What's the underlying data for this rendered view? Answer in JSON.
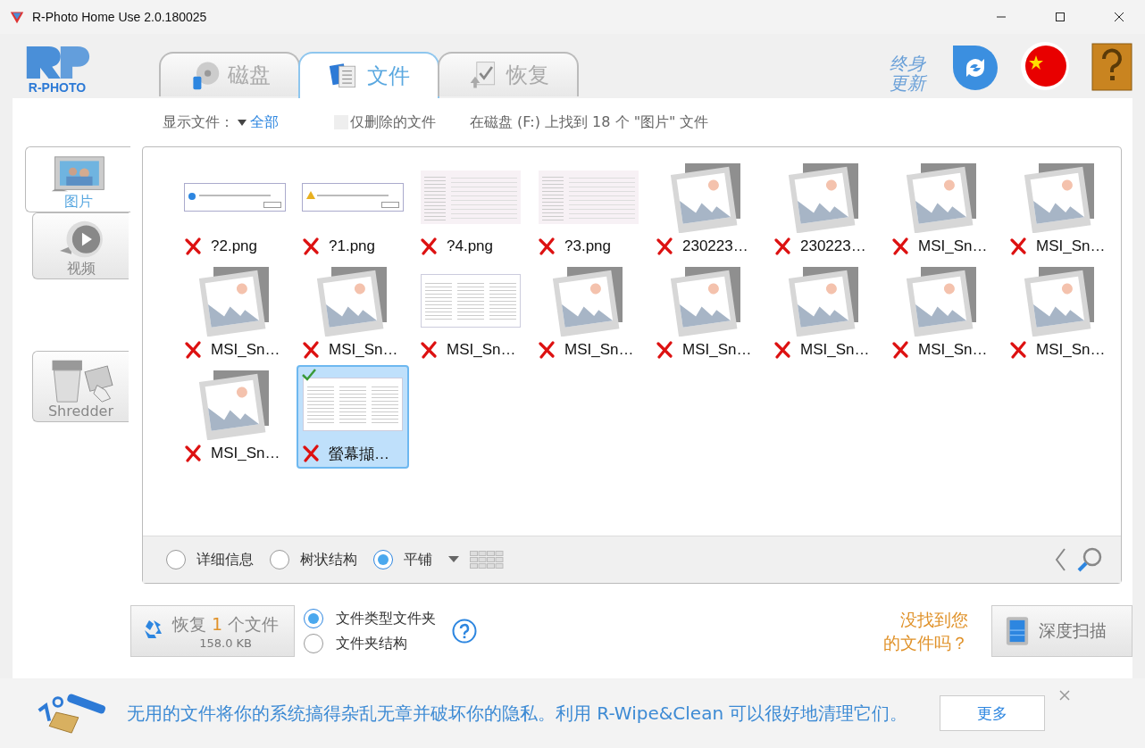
{
  "window": {
    "title": "R-Photo Home Use 2.0.180025"
  },
  "logo": {
    "text": "R-PHOTO"
  },
  "tabs": [
    {
      "label": "磁盘",
      "selected": false,
      "kind": "disk"
    },
    {
      "label": "文件",
      "selected": true,
      "kind": "files"
    },
    {
      "label": "恢复",
      "selected": false,
      "kind": "recover"
    }
  ],
  "update": {
    "lines": [
      "终身",
      "更新"
    ]
  },
  "filter": {
    "label": "显示文件：",
    "value": "全部",
    "deleted_only": {
      "label": "仅删除的文件",
      "checked": false
    },
    "summary": "在磁盘 (F:) 上找到 18 个 \"图片\" 文件"
  },
  "categories": [
    {
      "label": "图片",
      "selected": true,
      "kind": "photo"
    },
    {
      "label": "视频",
      "selected": false,
      "kind": "video"
    },
    {
      "label": "Shredder",
      "selected": false,
      "kind": "shredder"
    }
  ],
  "files": [
    {
      "name": "?2.png",
      "kind": "dialog",
      "selected": false,
      "checked": false
    },
    {
      "name": "?1.png",
      "kind": "warning",
      "selected": false,
      "checked": false
    },
    {
      "name": "?4.png",
      "kind": "page",
      "selected": false,
      "checked": false
    },
    {
      "name": "?3.png",
      "kind": "page",
      "selected": false,
      "checked": false
    },
    {
      "name": "230223…",
      "kind": "placeholder",
      "selected": false,
      "checked": false
    },
    {
      "name": "230223…",
      "kind": "placeholder",
      "selected": false,
      "checked": false
    },
    {
      "name": "MSI_Sn…",
      "kind": "placeholder",
      "selected": false,
      "checked": false
    },
    {
      "name": "MSI_Sn…",
      "kind": "placeholder",
      "selected": false,
      "checked": false
    },
    {
      "name": "MSI_Sn…",
      "kind": "placeholder",
      "selected": false,
      "checked": false
    },
    {
      "name": "MSI_Sn…",
      "kind": "placeholder",
      "selected": false,
      "checked": false
    },
    {
      "name": "MSI_Sn…",
      "kind": "window",
      "selected": false,
      "checked": false
    },
    {
      "name": "MSI_Sn…",
      "kind": "placeholder",
      "selected": false,
      "checked": false
    },
    {
      "name": "MSI_Sn…",
      "kind": "placeholder",
      "selected": false,
      "checked": false
    },
    {
      "name": "MSI_Sn…",
      "kind": "placeholder",
      "selected": false,
      "checked": false
    },
    {
      "name": "MSI_Sn…",
      "kind": "placeholder",
      "selected": false,
      "checked": false
    },
    {
      "name": "MSI_Sn…",
      "kind": "placeholder",
      "selected": false,
      "checked": false
    },
    {
      "name": "MSI_Sn…",
      "kind": "placeholder",
      "selected": false,
      "checked": false
    },
    {
      "name": "螢幕擷…",
      "kind": "window",
      "selected": true,
      "checked": true
    }
  ],
  "view_modes": [
    {
      "label": "详细信息",
      "selected": false
    },
    {
      "label": "树状结构",
      "selected": false
    },
    {
      "label": "平铺",
      "selected": true
    }
  ],
  "recover": {
    "prefix": "恢复",
    "count": "1",
    "suffix": "个文件",
    "size": "158.0 KB"
  },
  "structure_options": [
    {
      "label": "文件类型文件夹",
      "selected": true
    },
    {
      "label": "文件夹结构",
      "selected": false
    }
  ],
  "not_found": {
    "lines": [
      "没找到您",
      "的文件吗？"
    ]
  },
  "deep_scan": {
    "label": "深度扫描"
  },
  "banner": {
    "text": "无用的文件将你的系统搞得杂乱无章并破坏你的隐私。利用 R-Wipe&Clean 可以很好地清理它们。",
    "more": "更多"
  }
}
